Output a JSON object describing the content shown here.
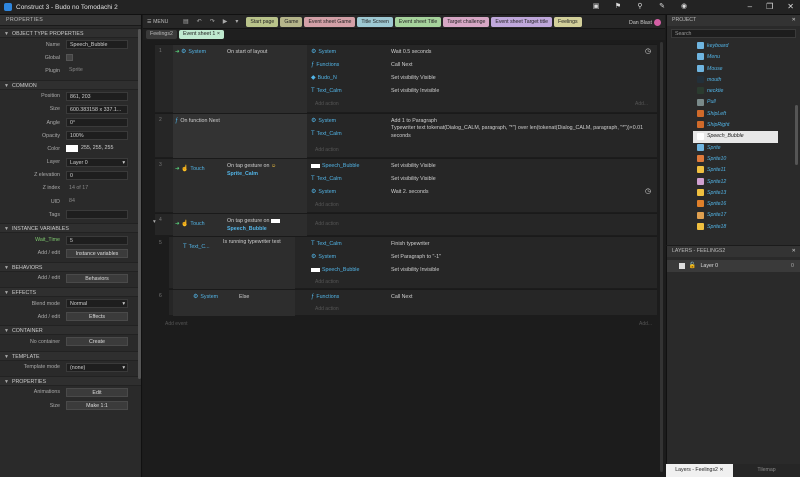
{
  "title": "Construct 3 - Budo no Tomodachi 2",
  "left": {
    "header": "PROPERTIES",
    "sections": {
      "object_type": "OBJECT TYPE PROPERTIES",
      "common": "COMMON",
      "instvars": "INSTANCE VARIABLES",
      "behaviors": "BEHAVIORS",
      "effects": "EFFECTS",
      "container": "CONTAINER",
      "template": "TEMPLATE",
      "properties": "PROPERTIES"
    },
    "name_label": "Name",
    "name_value": "Speech_Bubble",
    "global_label": "Global",
    "plugin_label": "Plugin",
    "plugin_value": "Sprite",
    "position_label": "Position",
    "position_value": "861, 203",
    "size_label": "Size",
    "size_value": "600.383158 x 337.1...",
    "angle_label": "Angle",
    "angle_value": "0°",
    "opacity_label": "Opacity",
    "opacity_value": "100%",
    "color_label": "Color",
    "color_value": "255, 255, 255",
    "layer_label": "Layer",
    "layer_value": "Layer 0",
    "zelev_label": "Z elevation",
    "zelev_value": "0",
    "zindex_label": "Z index",
    "zindex_value": "14 of 17",
    "uid_label": "UID",
    "uid_value": "84",
    "tags_label": "Tags",
    "wait_label": "Wait_Time",
    "wait_value": "5",
    "addedit": "Add / edit",
    "instvar_btn": "Instance variables",
    "behaviors_btn": "Behaviors",
    "blend_label": "Blend mode",
    "blend_value": "Normal",
    "effects_btn": "Effects",
    "no_container": "No container",
    "create_btn": "Create",
    "tmpl_label": "Template mode",
    "tmpl_value": "(none)",
    "anim_label": "Animations",
    "edit_btn": "Edit",
    "size2_label": "Size",
    "make11_btn": "Make 1:1"
  },
  "topbar": {
    "menu": "MENU",
    "tabs": [
      {
        "label": "Start page",
        "color": "#b9c38a"
      },
      {
        "label": "Game",
        "color": "#b5b58a"
      },
      {
        "label": "Event sheet Game",
        "color": "#d3a0a7"
      },
      {
        "label": "Title Screen",
        "color": "#9ec9d3"
      },
      {
        "label": "Event sheet Title",
        "color": "#a6d39c"
      },
      {
        "label": "Target challenge",
        "color": "#d7a7c5"
      },
      {
        "label": "Event sheet Target title",
        "color": "#c0a8dc"
      },
      {
        "label": "Feelings",
        "color": "#d3d09a"
      }
    ],
    "user": "Dan Blast"
  },
  "sheet_tabs": {
    "inactive": "Feelings2",
    "active": "Event sheet 1",
    "close": "×"
  },
  "events": {
    "e1": {
      "num": "1",
      "cond_obj": "System",
      "cond_text": "On start of layout",
      "a1_obj": "System",
      "a1": "Wait 0.5 seconds",
      "a2_obj": "Functions",
      "a2": "Call Next",
      "a3_obj": "Budo_N",
      "a3": "Set visibility Visible",
      "a4_obj": "Text_Calm",
      "a4": "Set visibility Invisible",
      "add_action": "Add action",
      "add": "Add..."
    },
    "e2": {
      "num": "2",
      "cond_text": "On function Next",
      "a1_obj": "System",
      "a1": "Add 1 to Paragraph",
      "a2_obj": "Text_Calm",
      "a2": "Typewriter text tokenat(Dialog_CALM, paragraph, \"*\") over len(tokenat(Dialog_CALM, paragraph, \"*\"))×0.01 seconds",
      "add_action": "Add action"
    },
    "e3": {
      "num": "3",
      "cond_obj": "Touch",
      "cond_text": "On tap gesture on",
      "cond_target": "Sprite_Calm",
      "a1_obj": "Speech_Bubble",
      "a1": "Set visibility Visible",
      "a2_obj": "Text_Calm",
      "a2": "Set visibility Visible",
      "a3_obj": "System",
      "a3": "Wait 2. seconds",
      "add_action": "Add action"
    },
    "e4": {
      "num": "4",
      "cond_obj": "Touch",
      "cond_text": "On tap gesture on",
      "cond_target": "Speech_Bubble",
      "add_action": "Add action"
    },
    "e5": {
      "num": "5",
      "cond_obj": "Text_C...",
      "cond_text": "Is running typewriter text",
      "a1_obj": "Text_Calm",
      "a1": "Finish typewriter",
      "a2_obj": "System",
      "a2": "Set Paragraph to \"-1\"",
      "a3_obj": "Speech_Bubble",
      "a3": "Set visibility Invisible",
      "add_action": "Add action"
    },
    "e6": {
      "num": "6",
      "cond_obj": "System",
      "cond_text": "Else",
      "a1_obj": "Functions",
      "a1": "Call Next",
      "add_action": "Add action",
      "add": "Add..."
    },
    "add_event": "Add event"
  },
  "project": {
    "header": "PROJECT",
    "search": "Search",
    "items": [
      {
        "label": "keyboard",
        "color": "#6fb5e0"
      },
      {
        "label": "Menu",
        "color": "#6fb5e0"
      },
      {
        "label": "Mouse",
        "color": "#6fb5e0"
      },
      {
        "label": "mouth",
        "color": "#23303a"
      },
      {
        "label": "necktie",
        "color": "#2b3b2f"
      },
      {
        "label": "Pull",
        "color": "#7a8a8a"
      },
      {
        "label": "ShipLeft",
        "color": "#d06a2a"
      },
      {
        "label": "ShipRight",
        "color": "#d06a2a"
      },
      {
        "label": "Speech_Bubble",
        "color": "#ffffff"
      },
      {
        "label": "Sprite",
        "color": "#6fb5e0"
      },
      {
        "label": "Sprite10",
        "color": "#e07a3a"
      },
      {
        "label": "Sprite11",
        "color": "#f0c040"
      },
      {
        "label": "Sprite12",
        "color": "#d0a0d0"
      },
      {
        "label": "Sprite13",
        "color": "#f0c040"
      },
      {
        "label": "Sprite16",
        "color": "#e0802a"
      },
      {
        "label": "Sprite17",
        "color": "#e0a050"
      },
      {
        "label": "Sprite18",
        "color": "#f0c040"
      }
    ]
  },
  "layers": {
    "header": "LAYERS - FEELINGS2",
    "layer": "Layer 0",
    "count": "0"
  },
  "bottom_tabs": {
    "t1": "Layers - Feelings2",
    "t2": "Tilemap"
  }
}
